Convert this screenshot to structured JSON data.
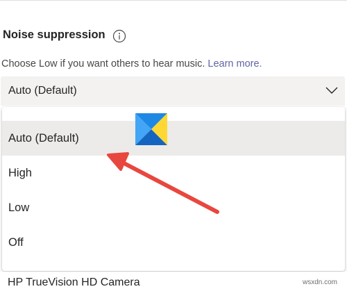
{
  "noise_suppression": {
    "title": "Noise suppression",
    "description": "Choose Low if you want others to hear music.",
    "learn_more": "Learn more.",
    "icon": "info-icon"
  },
  "select": {
    "value": "Auto (Default)",
    "icon": "chevron-down-icon"
  },
  "dropdown": {
    "options": [
      {
        "label": "Auto (Default)",
        "selected": true
      },
      {
        "label": "High",
        "selected": false
      },
      {
        "label": "Low",
        "selected": false
      },
      {
        "label": "Off",
        "selected": false
      }
    ],
    "selected_bg": "#edebe9"
  },
  "camera": {
    "device_label": "HP TrueVision HD Camera"
  },
  "colors": {
    "link": "#6264a7",
    "arrow": "#e8473f",
    "logo_blue": "#1e88e5",
    "logo_yellow": "#fdd835"
  },
  "watermark": {
    "site": "wsxdn.com"
  }
}
